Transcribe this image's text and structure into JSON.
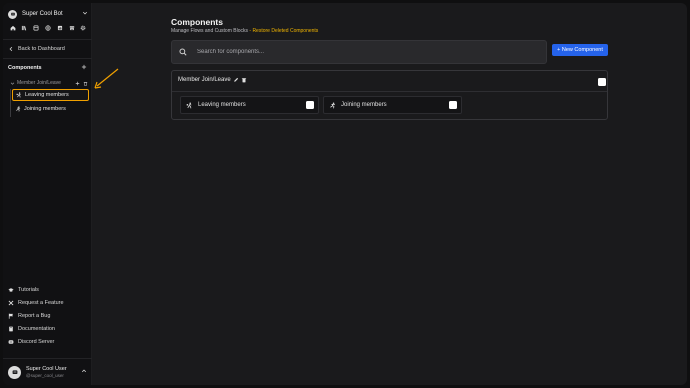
{
  "sidebar": {
    "bot_name": "Super Cool Bot",
    "icons": [
      "home-icon",
      "library-icon",
      "box-icon",
      "globe-icon",
      "chart-icon",
      "store-icon",
      "settings-icon"
    ],
    "back_label": "Back to Dashboard",
    "components_title": "Components",
    "group_label": "Member Join/Leave",
    "items": [
      {
        "label": "Leaving members",
        "icon": "person-walking-icon",
        "selected": true
      },
      {
        "label": "Joining members",
        "icon": "person-running-icon",
        "selected": false
      }
    ],
    "footer_links": [
      {
        "label": "Tutorials",
        "icon": "graduation-cap-icon"
      },
      {
        "label": "Request a Feature",
        "icon": "tools-icon"
      },
      {
        "label": "Report a Bug",
        "icon": "flag-icon"
      },
      {
        "label": "Documentation",
        "icon": "book-icon"
      },
      {
        "label": "Discord Server",
        "icon": "discord-icon"
      }
    ],
    "user": {
      "name": "Super Cool User",
      "handle": "@super_cool_user"
    }
  },
  "main": {
    "title": "Components",
    "subtitle": "Manage Flows and Custom Blocks",
    "subtitle_sep": " - ",
    "restore_link": "Restore Deleted Components",
    "search_placeholder": "Search for components...",
    "new_button": "+ New Component",
    "group": {
      "name": "Member Join/Leave",
      "components": [
        {
          "label": "Leaving members",
          "icon": "person-walking-icon"
        },
        {
          "label": "Joining members",
          "icon": "person-running-icon"
        }
      ]
    }
  },
  "colors": {
    "accent": "#2563eb",
    "highlight": "#f0a000",
    "link": "#f0b400",
    "background": "#1a1a1c"
  }
}
